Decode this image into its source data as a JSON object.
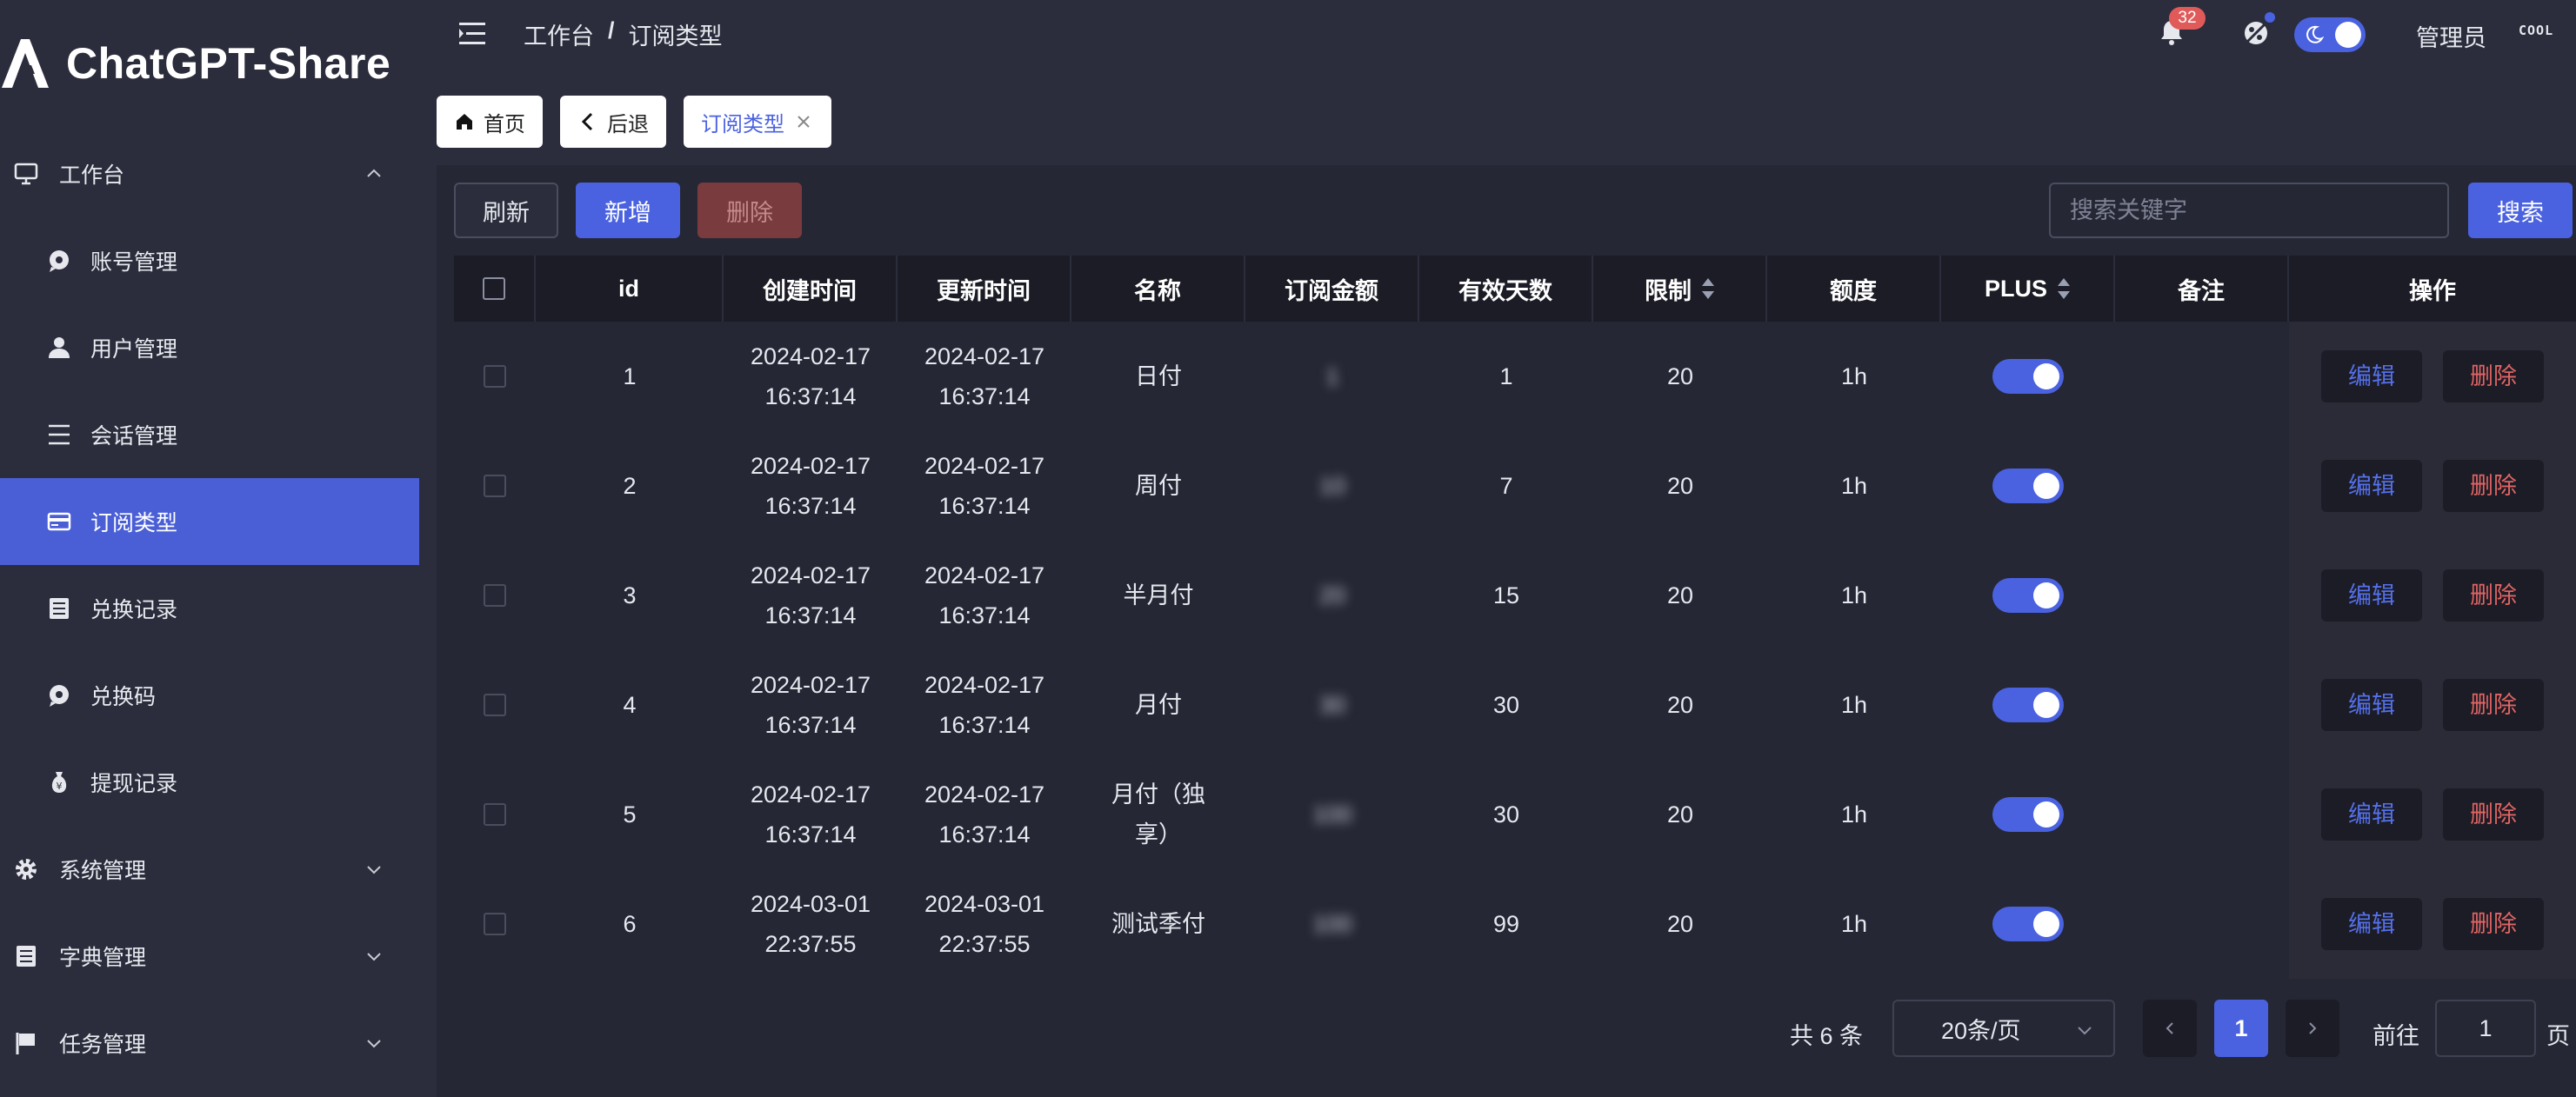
{
  "app": {
    "title": "ChatGPT-Share"
  },
  "sidebar": {
    "items": [
      {
        "label": "工作台",
        "type": "top",
        "expanded": true,
        "icon": "monitor-icon"
      },
      {
        "label": "账号管理",
        "type": "sub",
        "icon": "chat-bubble-icon"
      },
      {
        "label": "用户管理",
        "type": "sub",
        "icon": "user-icon"
      },
      {
        "label": "会话管理",
        "type": "sub",
        "icon": "lines-icon"
      },
      {
        "label": "订阅类型",
        "type": "sub",
        "active": true,
        "icon": "card-icon"
      },
      {
        "label": "兑换记录",
        "type": "sub",
        "icon": "list-icon"
      },
      {
        "label": "兑换码",
        "type": "sub",
        "icon": "chat-bubble-icon"
      },
      {
        "label": "提现记录",
        "type": "sub",
        "icon": "money-bag-icon"
      },
      {
        "label": "系统管理",
        "type": "top",
        "icon": "gear-icon"
      },
      {
        "label": "字典管理",
        "type": "top",
        "icon": "list-icon"
      },
      {
        "label": "任务管理",
        "type": "top",
        "icon": "flag-icon"
      }
    ]
  },
  "header": {
    "breadcrumb": [
      "工作台",
      "订阅类型"
    ],
    "breadcrumb_sep": "/",
    "notification_count": "32",
    "user": "管理员",
    "avatar_text": "COOL"
  },
  "tabs": {
    "home": "首页",
    "back": "后退",
    "current": "订阅类型"
  },
  "toolbar": {
    "refresh": "刷新",
    "add": "新增",
    "delete": "删除",
    "search_placeholder": "搜索关键字",
    "search": "搜索"
  },
  "table": {
    "columns": {
      "id": "id",
      "created": "创建时间",
      "updated": "更新时间",
      "name": "名称",
      "amount": "订阅金额",
      "days": "有效天数",
      "limit": "限制",
      "quota": "额度",
      "plus": "PLUS",
      "remark": "备注",
      "ops": "操作"
    },
    "rows": [
      {
        "id": "1",
        "created_d": "2024-02-17",
        "created_t": "16:37:14",
        "updated_d": "2024-02-17",
        "updated_t": "16:37:14",
        "name": "日付",
        "amount": "1",
        "days": "1",
        "limit": "20",
        "quota": "1h",
        "plus": true,
        "remark": ""
      },
      {
        "id": "2",
        "created_d": "2024-02-17",
        "created_t": "16:37:14",
        "updated_d": "2024-02-17",
        "updated_t": "16:37:14",
        "name": "周付",
        "amount": "10",
        "days": "7",
        "limit": "20",
        "quota": "1h",
        "plus": true,
        "remark": ""
      },
      {
        "id": "3",
        "created_d": "2024-02-17",
        "created_t": "16:37:14",
        "updated_d": "2024-02-17",
        "updated_t": "16:37:14",
        "name": "半月付",
        "amount": "20",
        "days": "15",
        "limit": "20",
        "quota": "1h",
        "plus": true,
        "remark": ""
      },
      {
        "id": "4",
        "created_d": "2024-02-17",
        "created_t": "16:37:14",
        "updated_d": "2024-02-17",
        "updated_t": "16:37:14",
        "name": "月付",
        "amount": "30",
        "days": "30",
        "limit": "20",
        "quota": "1h",
        "plus": true,
        "remark": ""
      },
      {
        "id": "5",
        "created_d": "2024-02-17",
        "created_t": "16:37:14",
        "updated_d": "2024-02-17",
        "updated_t": "16:37:14",
        "name": "月付（独享）",
        "amount": "100",
        "days": "30",
        "limit": "20",
        "quota": "1h",
        "plus": true,
        "remark": ""
      },
      {
        "id": "6",
        "created_d": "2024-03-01",
        "created_t": "22:37:55",
        "updated_d": "2024-03-01",
        "updated_t": "22:37:55",
        "name": "测试季付",
        "amount": "100",
        "days": "99",
        "limit": "20",
        "quota": "1h",
        "plus": true,
        "remark": ""
      }
    ],
    "edit_label": "编辑",
    "delete_label": "删除"
  },
  "pagination": {
    "total": "共 6 条",
    "page_size": "20条/页",
    "current_page": "1",
    "goto_label": "前往",
    "goto_value": "1",
    "page_suffix": "页"
  },
  "colors": {
    "accent": "#4a62e0",
    "danger": "#e06464",
    "sidebar_bg": "#2b2d3c",
    "content_bg": "#252735"
  }
}
